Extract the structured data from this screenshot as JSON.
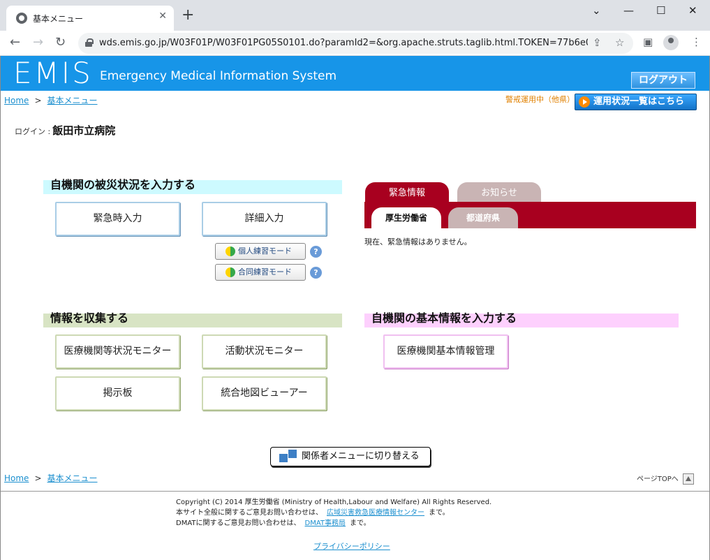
{
  "browser": {
    "tab_title": "基本メニュー",
    "url": "wds.emis.go.jp/W03F01P/W03F01PG05S0101.do?paramId2=&org.apache.struts.taglib.html.TOKEN=77b6e033d...",
    "icons": [
      "back-icon",
      "forward-icon",
      "reload-icon",
      "lock-icon",
      "share-icon",
      "star-icon",
      "sidebar-icon",
      "profile-icon",
      "menu-icon"
    ]
  },
  "header": {
    "logo": "EMIS",
    "subtitle": "Emergency Medical Information System",
    "logout_label": "ログアウト"
  },
  "breadcrumb": {
    "home": "Home",
    "separator": ">",
    "current": "基本メニュー"
  },
  "status": {
    "note": "警戒運用中（他県）",
    "button_label": "運用状況一覧はこちら"
  },
  "login": {
    "label": "ログイン :",
    "hospital": "飯田市立病院"
  },
  "sections": {
    "damage_input": {
      "title": "自機関の被災状況を入力する",
      "emergency_input": "緊急時入力",
      "detail_input": "詳細入力",
      "personal_practice": "個人練習モード",
      "joint_practice": "合同練習モード",
      "help": "?"
    },
    "collect_info": {
      "title": "情報を収集する",
      "monitor": "医療機関等状況モニター",
      "activity_monitor": "活動状況モニター",
      "board": "掲示板",
      "map_viewer": "統合地図ビューアー"
    },
    "basic_info": {
      "title": "自機関の基本情報を入力する",
      "manage": "医療機関基本情報管理"
    }
  },
  "news": {
    "tabs": [
      "緊急情報",
      "お知らせ"
    ],
    "subtabs": [
      "厚生労働省",
      "都道府県"
    ],
    "message": "現在、緊急情報はありません。"
  },
  "switch_menu": "関係者メニューに切り替える",
  "page_top": "ページTOPへ",
  "footer": {
    "copyright": "Copyright (C) 2014 厚生労働省 (Ministry of Health,Labour and Welfare) All Rights Reserved.",
    "line2_prefix": "本サイト全般に関するご意見お問い合わせは、",
    "line2_link": "広域災害救急医療情報センター",
    "line2_suffix": "まで。",
    "line3_prefix": "DMATに関するご意見お問い合わせは、",
    "line3_link": "DMAT事務局",
    "line3_suffix": "まで。",
    "privacy": "プライバシーポリシー"
  }
}
